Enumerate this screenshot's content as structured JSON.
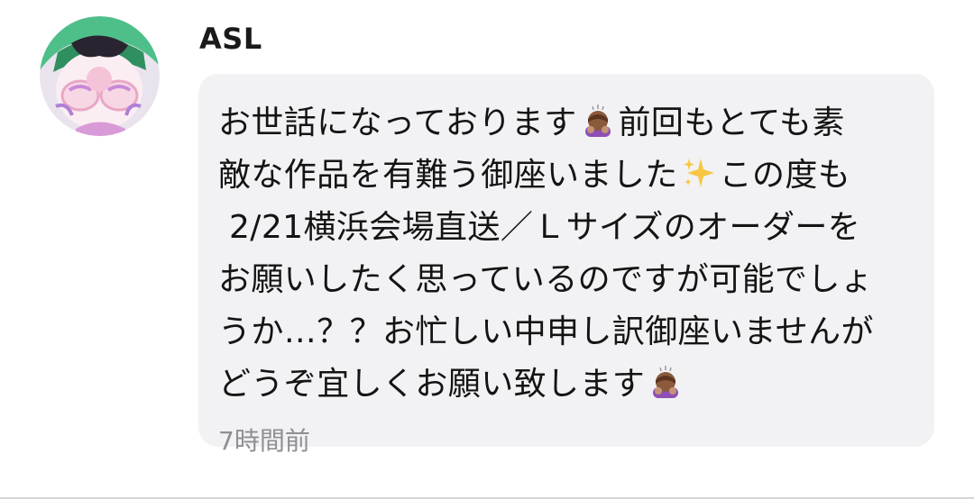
{
  "sender": {
    "name": "ASL",
    "avatar_icon": "anime-character-avatar"
  },
  "message": {
    "line_1": "お世話になっております",
    "line_1b": "前回もとても素",
    "line_2": "敵な作品を有難う御座いました",
    "line_2b": "この度も",
    "line_3": "2/21横浜会場直送／Ｌサイズのオーダーを",
    "line_4": "お願いしたく思っているのですが可能でしょ",
    "line_5": "うか…？？お忙しい中申し訳御座いませんが",
    "line_6": "どうぞ宜しくお願い致します",
    "emojis": [
      "bowing-woman-emoji",
      "sparkles-emoji",
      "bowing-woman-emoji"
    ]
  },
  "timestamp": "7時間前",
  "colors": {
    "bubble": "#f2f2f4",
    "text": "#141414",
    "timestamp": "#8e8e93"
  }
}
